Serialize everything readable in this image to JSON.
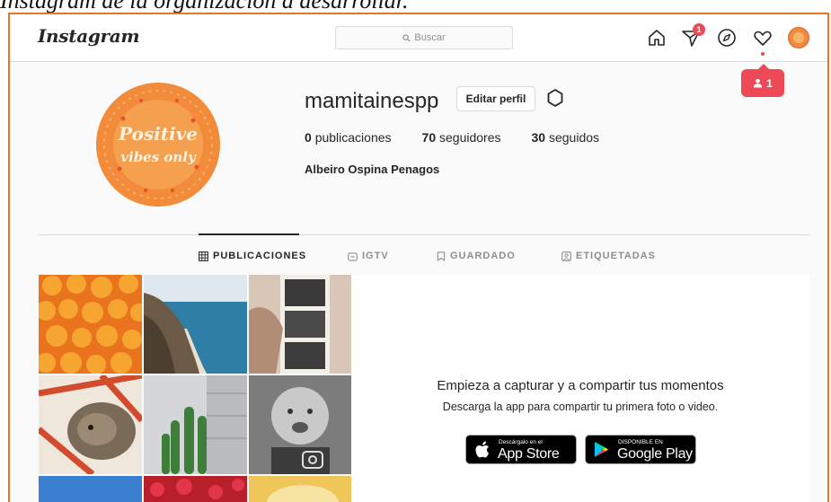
{
  "caption": "Instagram de la organización a desarrollar.",
  "header": {
    "logo": "Instagram",
    "search_placeholder": "Buscar",
    "direct_badge": "1",
    "notification_count": "1"
  },
  "profile": {
    "username": "mamitainespp",
    "edit_button": "Editar perfil",
    "stats": {
      "posts_count": "0",
      "posts_label": "publicaciones",
      "followers_count": "70",
      "followers_label": "seguidores",
      "following_count": "30",
      "following_label": "seguidos"
    },
    "full_name": "Albeiro Ospina Penagos",
    "picture_text_line1": "Positive",
    "picture_text_line2": "vibes only"
  },
  "tabs": [
    {
      "label": "PUBLICACIONES",
      "icon": "grid-icon",
      "active": true
    },
    {
      "label": "IGTV",
      "icon": "igtv-icon",
      "active": false
    },
    {
      "label": "GUARDADO",
      "icon": "bookmark-icon",
      "active": false
    },
    {
      "label": "ETIQUETADAS",
      "icon": "tag-icon",
      "active": false
    }
  ],
  "promo": {
    "title": "Empieza a capturar y a compartir tus momentos",
    "subtitle": "Descarga la app para compartir tu primera foto o video.",
    "app_store_small": "Descárgalo en el",
    "app_store_big": "App Store",
    "google_play_small": "DISPONIBLE EN",
    "google_play_big": "Google Play"
  },
  "colors": {
    "accent_red": "#ed4956",
    "frame_border": "#e0792a",
    "text": "#262626",
    "muted": "#8e8e8e"
  }
}
